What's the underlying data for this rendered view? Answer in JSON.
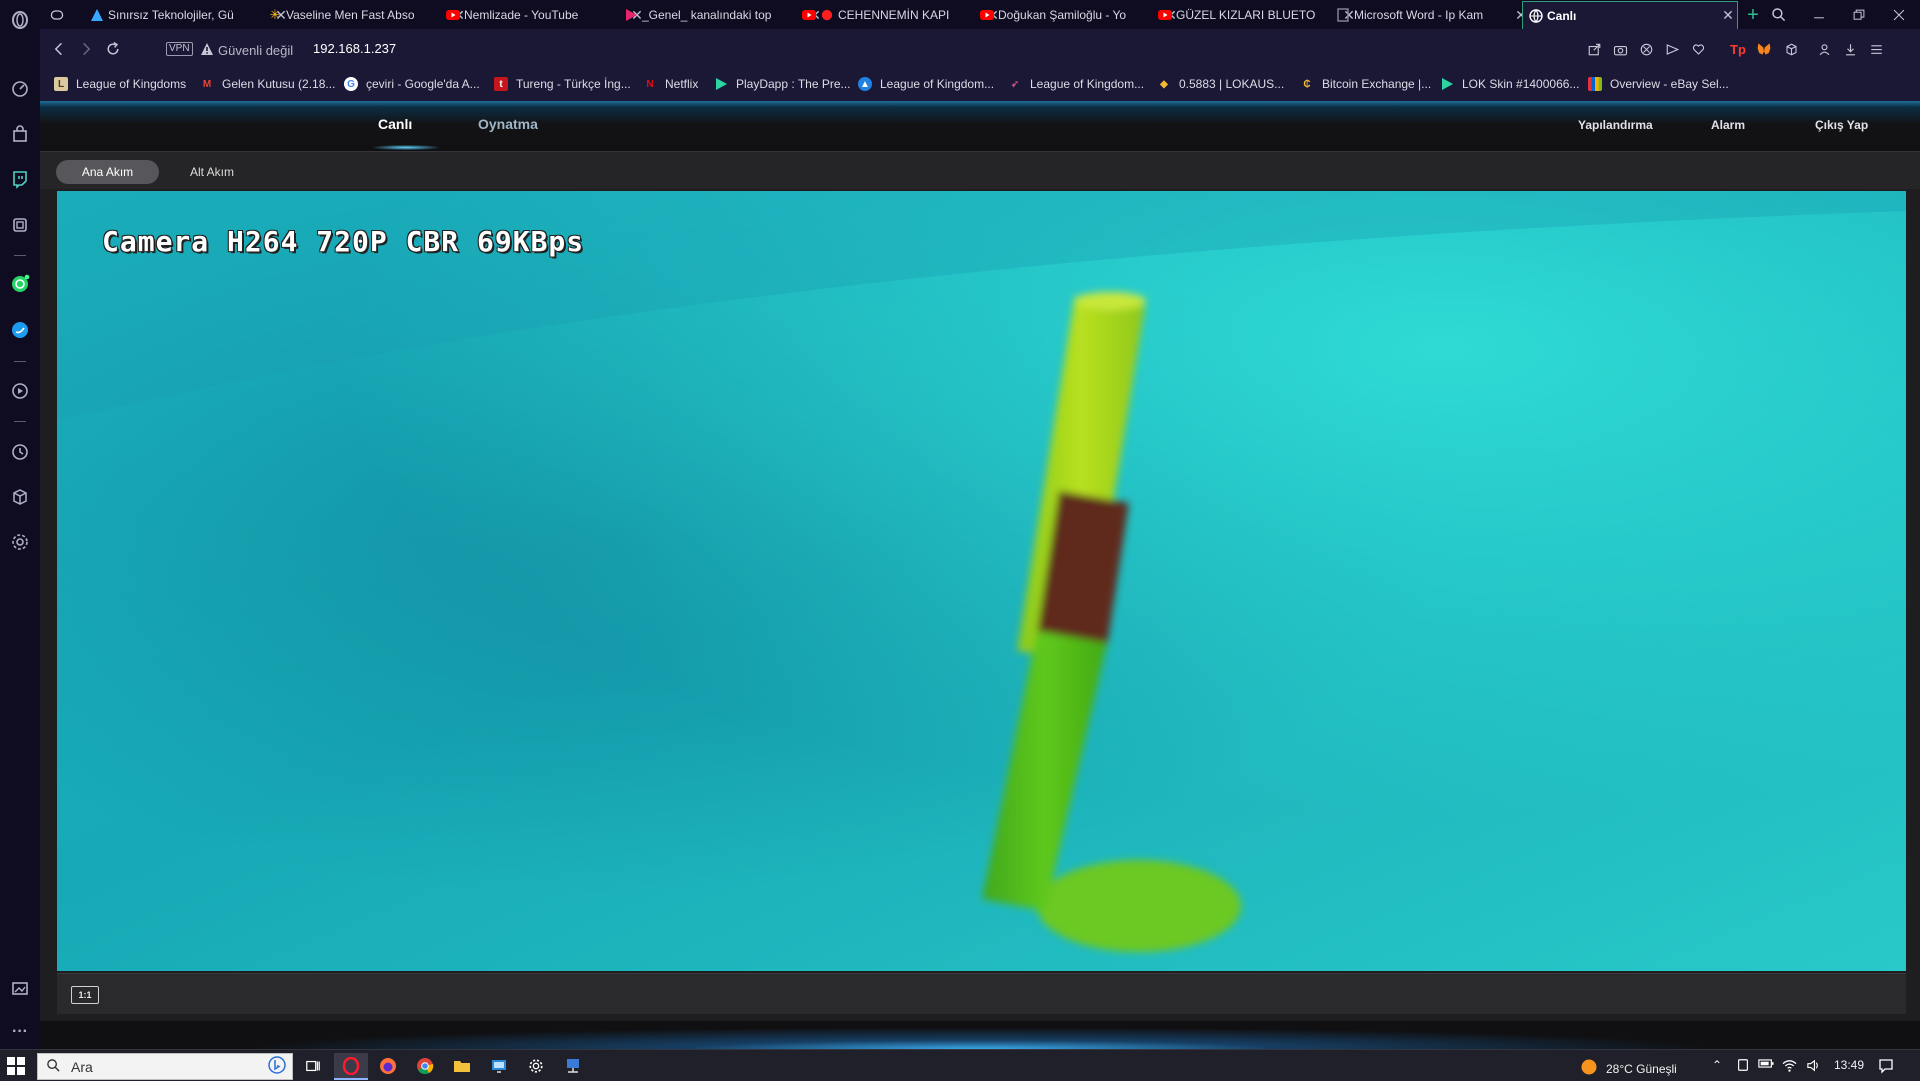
{
  "browser": {
    "tabs": [
      {
        "title": "Sınırsız Teknolojiler, Gü",
        "icon": "triangle-logo-icon",
        "icon_color": "#3aa8ff"
      },
      {
        "title": "Vaseline Men Fast Abso",
        "icon": "walmart-spark-icon",
        "icon_color": "#ffc220"
      },
      {
        "title": "Nemlizade - YouTube",
        "icon": "youtube-icon",
        "icon_color": "#ff0000"
      },
      {
        "title": "_Genel_ kanalındaki top",
        "icon": "play-arrow-icon",
        "icon_color": "#e5266c"
      },
      {
        "title": "CEHENNEMİN KAPI",
        "icon": "youtube-icon",
        "icon_color": "#ff0000"
      },
      {
        "title": "Doğukan Şamiloğlu - Yo",
        "icon": "youtube-icon",
        "icon_color": "#ff0000"
      },
      {
        "title": "GÜZEL KIZLARI BLUETO",
        "icon": "youtube-icon",
        "icon_color": "#ff0000"
      },
      {
        "title": "Microsoft Word - Ip Kam",
        "icon": "document-icon",
        "icon_color": "#8a8aa0"
      },
      {
        "title": "Canlı",
        "icon": "globe-icon",
        "icon_color": "#ffffff",
        "active": true
      }
    ],
    "new_tab_symbol": "+",
    "address": {
      "vpn_label": "VPN",
      "security_text": "Güvenli değil",
      "url": "192.168.1.237"
    },
    "bookmarks": [
      {
        "label": "League of Kingdoms",
        "icon": "lok-icon",
        "color": "#d9c8a0"
      },
      {
        "label": "Gelen Kutusu (2.18...",
        "icon": "gmail-icon",
        "color": "#ea4335"
      },
      {
        "label": "çeviri - Google'da A...",
        "icon": "google-icon",
        "color": "#ffffff"
      },
      {
        "label": "Tureng - Türkçe İng...",
        "icon": "tureng-icon",
        "color": "#c4161c"
      },
      {
        "label": "Netflix",
        "icon": "netflix-icon",
        "color": "#e50914"
      },
      {
        "label": "PlayDapp : The Pre...",
        "icon": "playdapp-icon",
        "color": "#2bd4a0"
      },
      {
        "label": "League of Kingdom...",
        "icon": "opensea-icon",
        "color": "#2081e2"
      },
      {
        "label": "League of Kingdom...",
        "icon": "bird-icon",
        "color": "#c44a7c"
      },
      {
        "label": "0.5883 | LOKAUS...",
        "icon": "binance-icon",
        "color": "#f3ba2f"
      },
      {
        "label": "Bitcoin Exchange |...",
        "icon": "coin-icon",
        "color": "#f3ba2f"
      },
      {
        "label": "LOK Skin #1400066...",
        "icon": "playdapp-icon",
        "color": "#2bd4a0"
      },
      {
        "label": "Overview - eBay Sel...",
        "icon": "ebay-icon",
        "color": "#e53238"
      }
    ]
  },
  "camera_ui": {
    "nav": {
      "live": "Canlı",
      "playback": "Oynatma",
      "config": "Yapılandırma",
      "alarm": "Alarm",
      "logout": "Çıkış Yap"
    },
    "streams": {
      "main": "Ana Akım",
      "sub": "Alt Akım"
    },
    "osd_text": "Camera H264 720P CBR 69KBps",
    "control_button": "1:1"
  },
  "taskbar": {
    "search_placeholder": "Ara",
    "weather": "28°C  Güneşli",
    "time": "13:49"
  }
}
